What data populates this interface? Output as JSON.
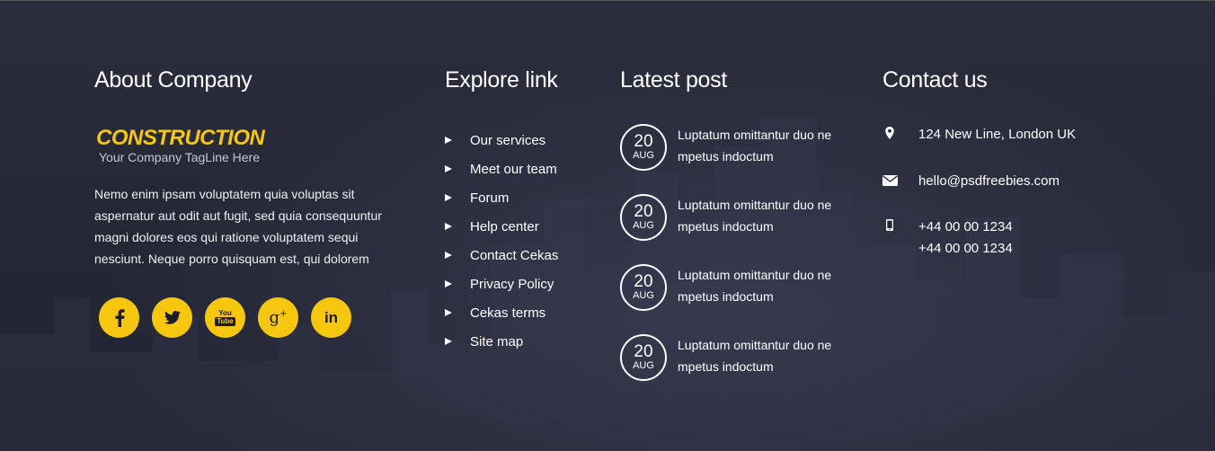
{
  "colors": {
    "accent": "#f7c70f",
    "background": "#262837",
    "text": "#ffffff"
  },
  "about": {
    "heading": "About Company",
    "logo_text": "CONSTRUCTION",
    "tagline": "Your Company TagLine Here",
    "description": "Nemo enim ipsam voluptatem quia voluptas sit aspernatur aut odit aut fugit, sed quia consequuntur magni dolores eos qui ratione voluptatem sequi nesciunt. Neque porro quisquam est, qui dolorem",
    "socials": [
      "facebook-icon",
      "twitter-icon",
      "youtube-icon",
      "google-plus-icon",
      "linkedin-icon"
    ],
    "youtube_label_1": "You",
    "youtube_label_2": "Tube"
  },
  "explore": {
    "heading": "Explore link",
    "links": [
      "Our services",
      "Meet our team",
      "Forum",
      "Help center",
      "Contact Cekas",
      "Privacy Policy",
      "Cekas terms",
      "Site map"
    ]
  },
  "latest": {
    "heading": "Latest post",
    "posts": [
      {
        "day": "20",
        "month": "AUG",
        "title": "Luptatum omittantur duo ne mpetus indoctum"
      },
      {
        "day": "20",
        "month": "AUG",
        "title": "Luptatum omittantur duo ne mpetus indoctum"
      },
      {
        "day": "20",
        "month": "AUG",
        "title": "Luptatum omittantur duo ne mpetus indoctum"
      },
      {
        "day": "20",
        "month": "AUG",
        "title": "Luptatum omittantur duo ne mpetus indoctum"
      }
    ]
  },
  "contact": {
    "heading": "Contact us",
    "address": "124 New Line, London UK",
    "email": "hello@psdfreebies.com",
    "phone_1": "+44 00 00 1234",
    "phone_2": "+44 00 00 1234",
    "icons": [
      "map-pin-icon",
      "envelope-icon",
      "mobile-phone-icon"
    ]
  }
}
